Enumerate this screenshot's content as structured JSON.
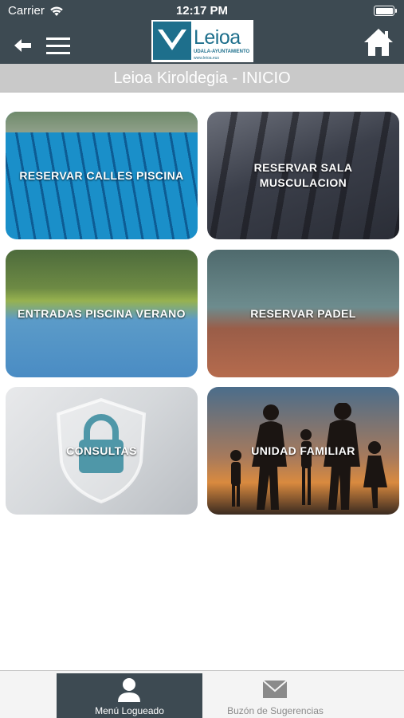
{
  "status_bar": {
    "carrier": "Carrier",
    "time": "12:17 PM"
  },
  "header": {
    "logo_name": "Leioa",
    "logo_subtitle": "UDALA-AYUNTAMIENTO",
    "logo_web": "www.leioa.eus",
    "back_icon": "arrow-left-icon",
    "menu_icon": "hamburger-icon",
    "home_icon": "home-icon"
  },
  "title": "Leioa Kiroldegia - INICIO",
  "tiles": [
    {
      "label": "RESERVAR CALLES PISCINA"
    },
    {
      "label": "RESERVAR SALA MUSCULACION"
    },
    {
      "label": "ENTRADAS PISCINA VERANO"
    },
    {
      "label": "RESERVAR PADEL"
    },
    {
      "label": "CONSULTAS"
    },
    {
      "label": "UNIDAD FAMILIAR"
    }
  ],
  "tab_bar": {
    "tabs": [
      {
        "label": "Menú Logueado",
        "icon": "person-icon",
        "active": true
      },
      {
        "label": "Buzón de Sugerencias",
        "icon": "envelope-icon",
        "active": false
      }
    ]
  },
  "colors": {
    "header_bg": "#3d4a52",
    "title_bg": "#c9c9c9",
    "active_tab_bg": "#3d4a52",
    "logo_blue": "#1e6f8c"
  }
}
